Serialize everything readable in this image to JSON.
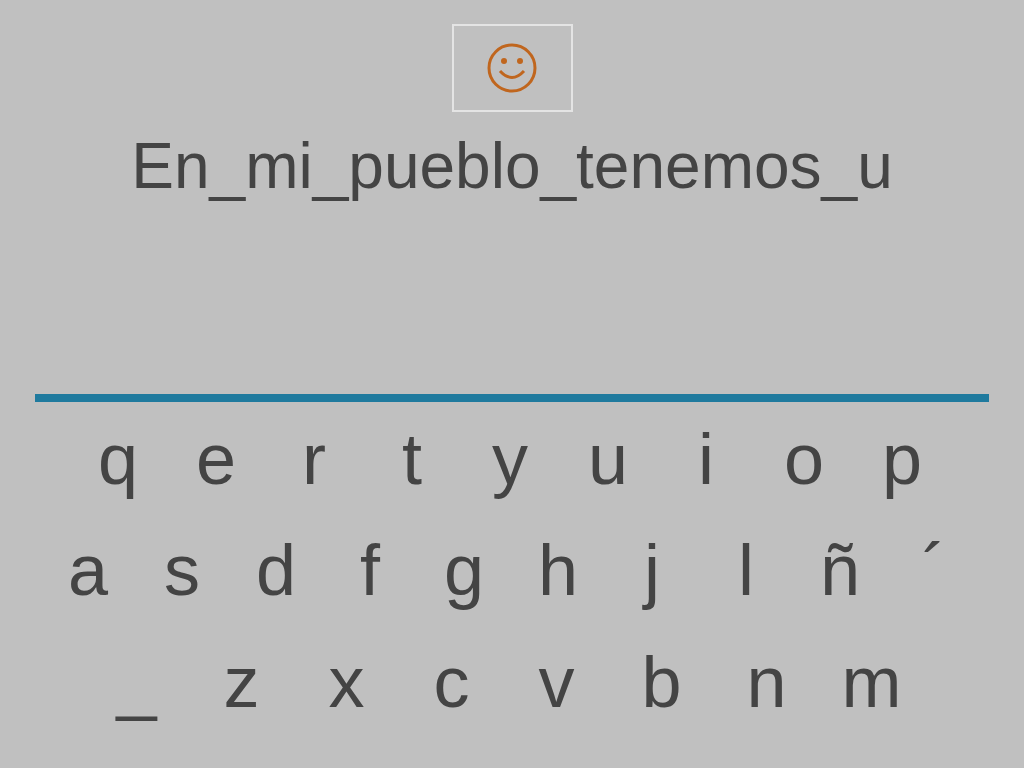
{
  "sentence": "En_mi_pueblo_tenemos_u",
  "keyboard": {
    "rows": [
      [
        "q",
        "e",
        "r",
        "t",
        "y",
        "u",
        "i",
        "o",
        "p"
      ],
      [
        "a",
        "s",
        "d",
        "f",
        "g",
        "h",
        "j",
        "l",
        "ñ",
        "´"
      ],
      [
        "_",
        "z",
        "x",
        "c",
        "v",
        "b",
        "n",
        "m"
      ]
    ]
  }
}
